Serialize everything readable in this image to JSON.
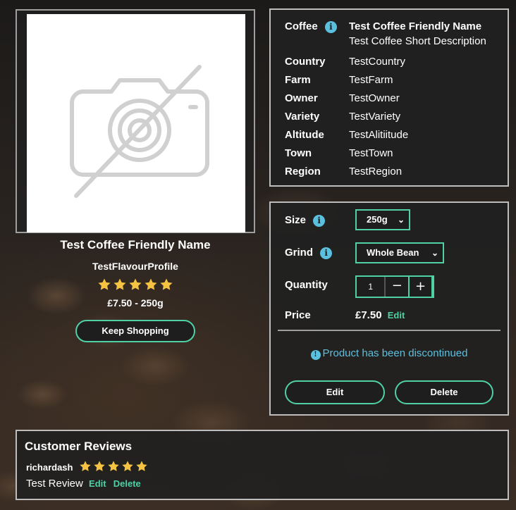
{
  "product": {
    "name": "Test Coffee Friendly Name",
    "flavour_profile": "TestFlavourProfile",
    "rating": 5,
    "price_size": "£7.50 - 250g",
    "keep_shopping_label": "Keep Shopping"
  },
  "details": {
    "coffee_label": "Coffee",
    "coffee_name": "Test Coffee Friendly Name",
    "short_description": "Test Coffee Short Description",
    "rows": [
      {
        "label": "Country",
        "value": "TestCountry"
      },
      {
        "label": "Farm",
        "value": "TestFarm"
      },
      {
        "label": "Owner",
        "value": "TestOwner"
      },
      {
        "label": "Variety",
        "value": "TestVariety"
      },
      {
        "label": "Altitude",
        "value": "TestAlitiitude"
      },
      {
        "label": "Town",
        "value": "TestTown"
      },
      {
        "label": "Region",
        "value": "TestRegion"
      }
    ]
  },
  "options": {
    "size_label": "Size",
    "size_value": "250g",
    "grind_label": "Grind",
    "grind_value": "Whole Bean",
    "quantity_label": "Quantity",
    "quantity_value": "1",
    "minus": "−",
    "plus": "+",
    "price_label": "Price",
    "price_value": "£7.50",
    "price_edit": "Edit",
    "notice": "Product has been discontinued",
    "edit_label": "Edit",
    "delete_label": "Delete"
  },
  "reviews": {
    "title": "Customer Reviews",
    "items": [
      {
        "user": "richardash",
        "rating": 5,
        "text": "Test Review",
        "edit": "Edit",
        "delete": "Delete"
      }
    ]
  },
  "colors": {
    "accent": "#4fd1a5",
    "info": "#5bc0de",
    "star": "#f5c242"
  },
  "icons": [
    "no-image-camera-icon",
    "info-icon",
    "star-icon",
    "chevron-down-icon"
  ]
}
